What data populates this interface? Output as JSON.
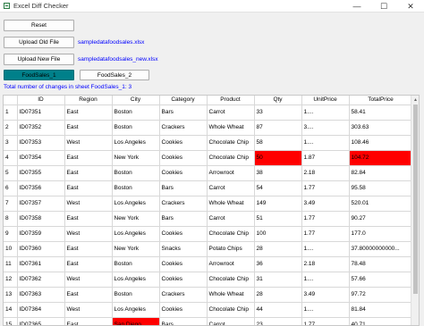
{
  "window": {
    "title": "Excel Diff Checker",
    "minimize": "—",
    "maximize": "☐",
    "close": "✕"
  },
  "controls": {
    "reset_label": "Reset",
    "upload_old_label": "Upload Old File",
    "old_filename": "sampledatafoodsales.xlsx",
    "upload_new_label": "Upload New File",
    "new_filename": "sampledatafoodsales_new.xlsx"
  },
  "tabs": [
    {
      "label": "FoodSales_1",
      "active": true
    },
    {
      "label": "FoodSales_2",
      "active": false
    }
  ],
  "summary": "Total number of changes in sheet FoodSales_1: 3",
  "highlight_color": "#ff0000",
  "accent_color": "#00808a",
  "table": {
    "headers": [
      "ID",
      "Region",
      "City",
      "Category",
      "Product",
      "Qty",
      "UnitPrice",
      "TotalPrice"
    ],
    "rows": [
      {
        "n": "1",
        "cells": [
          "ID07351",
          "East",
          "Boston",
          "Bars",
          "Carrot",
          "33",
          "1....",
          "58.41"
        ],
        "hl": []
      },
      {
        "n": "2",
        "cells": [
          "ID07352",
          "East",
          "Boston",
          "Crackers",
          "Whole Wheat",
          "87",
          "3....",
          "303.63"
        ],
        "hl": []
      },
      {
        "n": "3",
        "cells": [
          "ID07353",
          "West",
          "Los Angeles",
          "Cookies",
          "Chocolate Chip",
          "58",
          "1....",
          "108.46"
        ],
        "hl": []
      },
      {
        "n": "4",
        "cells": [
          "ID07354",
          "East",
          "New York",
          "Cookies",
          "Chocolate Chip",
          "50",
          "1.87",
          "104.72"
        ],
        "hl": [
          5,
          7
        ]
      },
      {
        "n": "5",
        "cells": [
          "ID07355",
          "East",
          "Boston",
          "Cookies",
          "Arrowroot",
          "38",
          "2.18",
          "82.84"
        ],
        "hl": []
      },
      {
        "n": "6",
        "cells": [
          "ID07356",
          "East",
          "Boston",
          "Bars",
          "Carrot",
          "54",
          "1.77",
          "95.58"
        ],
        "hl": []
      },
      {
        "n": "7",
        "cells": [
          "ID07357",
          "West",
          "Los Angeles",
          "Crackers",
          "Whole Wheat",
          "149",
          "3.49",
          "520.01"
        ],
        "hl": []
      },
      {
        "n": "8",
        "cells": [
          "ID07358",
          "East",
          "New York",
          "Bars",
          "Carrot",
          "51",
          "1.77",
          "90.27"
        ],
        "hl": []
      },
      {
        "n": "9",
        "cells": [
          "ID07359",
          "West",
          "Los Angeles",
          "Cookies",
          "Chocolate Chip",
          "100",
          "1.77",
          "177.0"
        ],
        "hl": []
      },
      {
        "n": "10",
        "cells": [
          "ID07360",
          "East",
          "New York",
          "Snacks",
          "Potato Chips",
          "28",
          "1....",
          "37.80000000000..."
        ],
        "hl": []
      },
      {
        "n": "11",
        "cells": [
          "ID07361",
          "East",
          "Boston",
          "Cookies",
          "Arrowroot",
          "36",
          "2.18",
          "78.48"
        ],
        "hl": []
      },
      {
        "n": "12",
        "cells": [
          "ID07362",
          "West",
          "Los Angeles",
          "Cookies",
          "Chocolate Chip",
          "31",
          "1....",
          "57.66"
        ],
        "hl": []
      },
      {
        "n": "13",
        "cells": [
          "ID07363",
          "East",
          "Boston",
          "Crackers",
          "Whole Wheat",
          "28",
          "3.49",
          "97.72"
        ],
        "hl": []
      },
      {
        "n": "14",
        "cells": [
          "ID07364",
          "West",
          "Los Angeles",
          "Cookies",
          "Chocolate Chip",
          "44",
          "1....",
          "81.84"
        ],
        "hl": []
      },
      {
        "n": "15",
        "cells": [
          "ID07365",
          "East",
          "San Diego",
          "Bars",
          "Carrot",
          "23",
          "1.77",
          "40.71"
        ],
        "hl": [
          2
        ]
      }
    ]
  }
}
